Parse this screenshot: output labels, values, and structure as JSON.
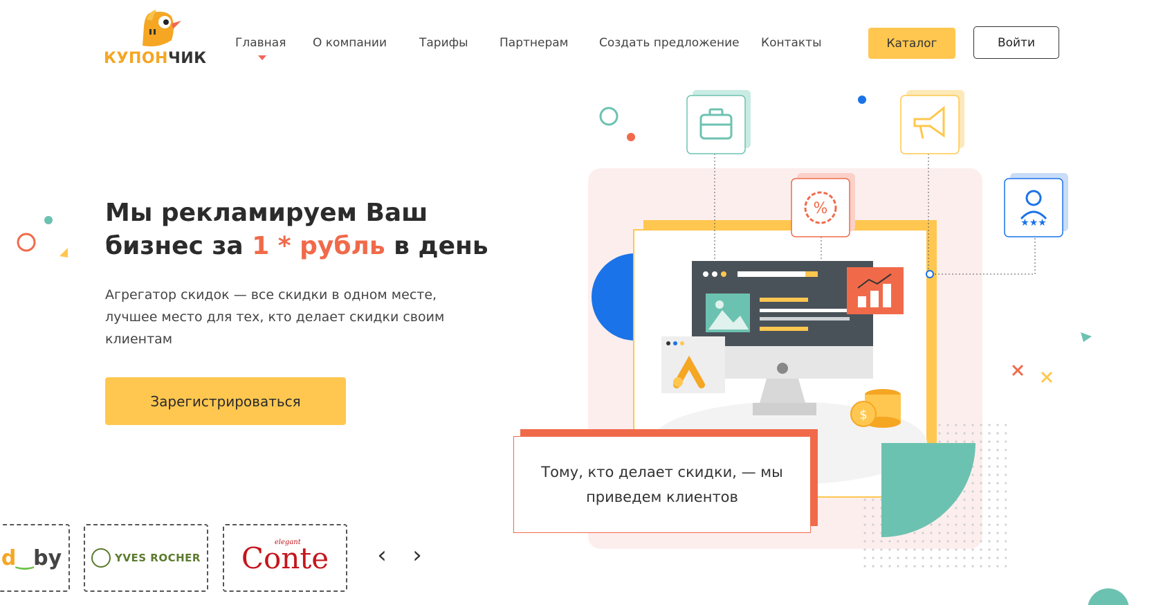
{
  "logo": {
    "part1": "КУПОН",
    "part2": "ЧИК"
  },
  "nav": {
    "items": [
      "Главная",
      "О компании",
      "Тарифы",
      "Партнерам",
      "Создать предложение",
      "Контакты"
    ],
    "catalog_label": "Каталог",
    "login_label": "Войти"
  },
  "hero": {
    "title_line1": "Мы рекламируем Ваш",
    "title_line2_pre": "бизнес за ",
    "title_accent": "1 * рубль",
    "title_line2_post": " в день",
    "subtitle": "Агрегатор скидок — все скидки в одном месте, лучшее место для тех, кто делает скидки своим клиентам",
    "register_label": "Зарегистрироваться"
  },
  "partners": {
    "p1_d": "d",
    "p1_rest": "by",
    "p2_name": "YVES ROCHER",
    "p3_name": "Conte",
    "p3_small": "elegant",
    "prev": "‹",
    "next": "›"
  },
  "illustration": {
    "quote": "Тому, кто делает скидки, — мы приведем клиентов",
    "coin_symbol": "$",
    "percent_symbol": "%"
  },
  "colors": {
    "accent_yellow": "#ffc74f",
    "accent_red": "#f06a4a",
    "teal": "#6cc2b0",
    "blue": "#1a73e8"
  }
}
